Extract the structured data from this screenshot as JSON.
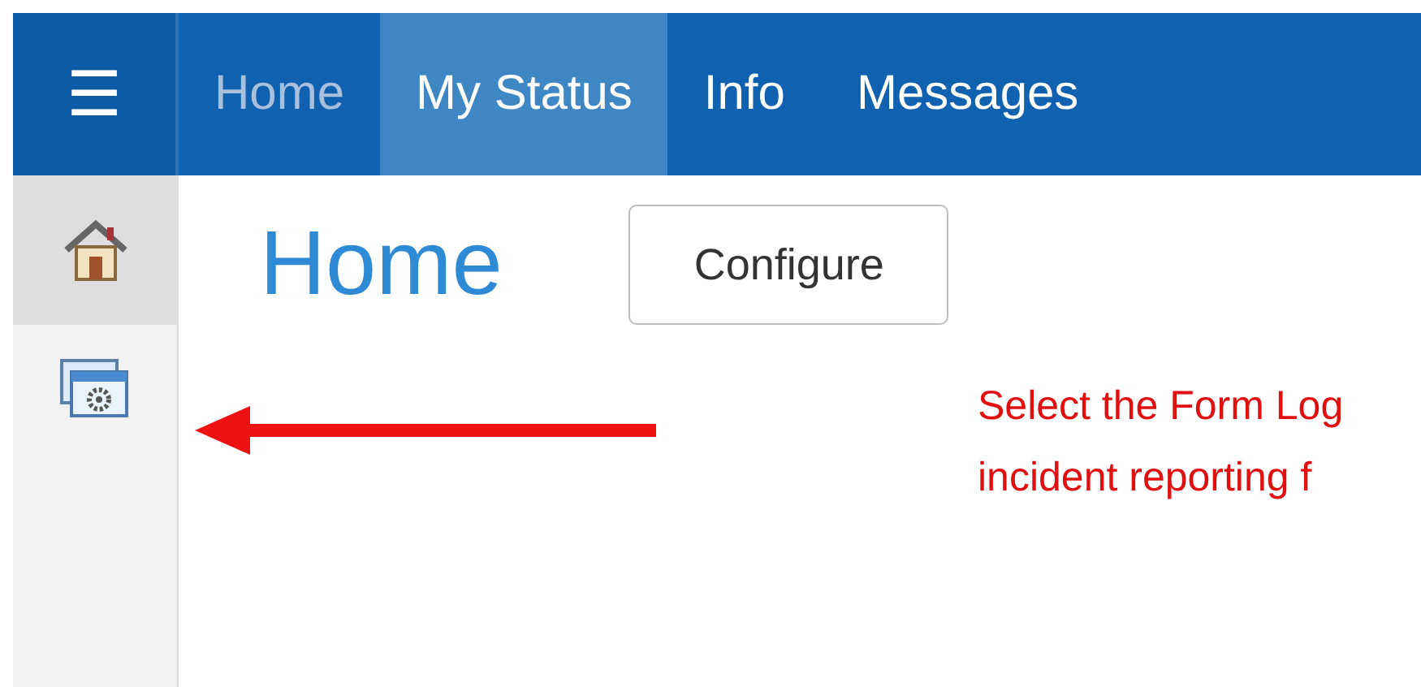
{
  "nav": {
    "menu_icon": "☰",
    "tabs": [
      {
        "label": "Home",
        "selected": false,
        "muted": true
      },
      {
        "label": "My Status",
        "selected": true,
        "muted": false
      },
      {
        "label": "Info",
        "selected": false,
        "muted": false
      },
      {
        "label": "Messages",
        "selected": false,
        "muted": false
      }
    ]
  },
  "sidebar": {
    "items": [
      {
        "kind": "home",
        "selected": true
      },
      {
        "kind": "settings-window",
        "selected": false
      }
    ]
  },
  "page": {
    "title": "Home",
    "button": "Configure"
  },
  "annotation": {
    "lines": [
      "Select the Form Log",
      "incident reporting f"
    ]
  }
}
